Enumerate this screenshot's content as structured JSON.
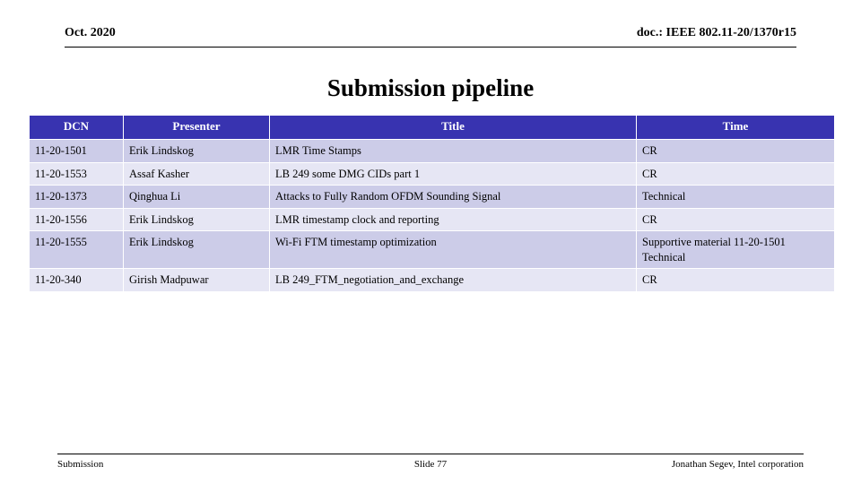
{
  "header": {
    "date": "Oct. 2020",
    "doc_id": "doc.: IEEE 802.11-20/1370r15"
  },
  "title": "Submission pipeline",
  "table": {
    "columns": [
      "DCN",
      "Presenter",
      "Title",
      "Time"
    ],
    "rows": [
      {
        "dcn": "11-20-1501",
        "presenter": "Erik Lindskog",
        "title": "LMR Time Stamps",
        "time": "CR"
      },
      {
        "dcn": "11-20-1553",
        "presenter": "Assaf Kasher",
        "title": "LB 249 some DMG CIDs part 1",
        "time": "CR"
      },
      {
        "dcn": "11-20-1373",
        "presenter": "Qinghua Li",
        "title": "Attacks to Fully Random OFDM Sounding Signal",
        "time": "Technical"
      },
      {
        "dcn": "11-20-1556",
        "presenter": "Erik Lindskog",
        "title": "LMR timestamp clock and reporting",
        "time": "CR"
      },
      {
        "dcn": "11-20-1555",
        "presenter": "Erik Lindskog",
        "title": "Wi-Fi FTM timestamp optimization",
        "time": "Supportive material 11-20-1501 Technical"
      },
      {
        "dcn": "11-20-340",
        "presenter": "Girish Madpuwar",
        "title": "LB 249_FTM_negotiation_and_exchange",
        "time": "CR"
      }
    ]
  },
  "footer": {
    "left": "Submission",
    "center": "Slide 77",
    "right": "Jonathan Segev, Intel corporation"
  },
  "colors": {
    "header_blue": "#3833B0",
    "row_shade": "#CCCCE8",
    "row_light": "#E6E6F4",
    "text": "#000000"
  }
}
